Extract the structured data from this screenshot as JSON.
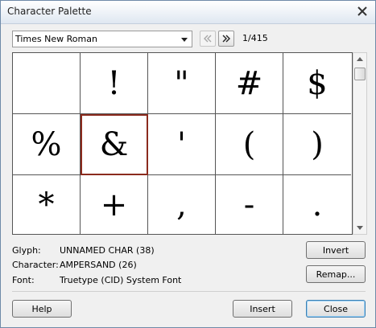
{
  "window": {
    "title": "Character Palette"
  },
  "font_select": {
    "value": "Times New Roman"
  },
  "pager": {
    "text": "1/415"
  },
  "glyphs": [
    "",
    "!",
    "\"",
    "#",
    "$",
    "%",
    "&",
    "'",
    "(",
    ")",
    "*",
    "+",
    ",",
    "-",
    "."
  ],
  "selected_index": 6,
  "info": {
    "glyph_label": "Glyph:",
    "glyph_value": "UNNAMED CHAR (38)",
    "character_label": "Character:",
    "character_value": "AMPERSAND (26)",
    "font_label": "Font:",
    "font_value": "Truetype (CID) System Font"
  },
  "buttons": {
    "invert": "Invert",
    "remap": "Remap...",
    "help": "Help",
    "insert": "Insert",
    "close": "Close"
  },
  "icons": {
    "close": "close-x-icon",
    "dropdown": "chevron-down-icon",
    "prev": "double-chevron-left-icon",
    "next": "double-chevron-right-icon",
    "scroll_up": "triangle-up-icon",
    "scroll_down": "triangle-down-icon"
  }
}
